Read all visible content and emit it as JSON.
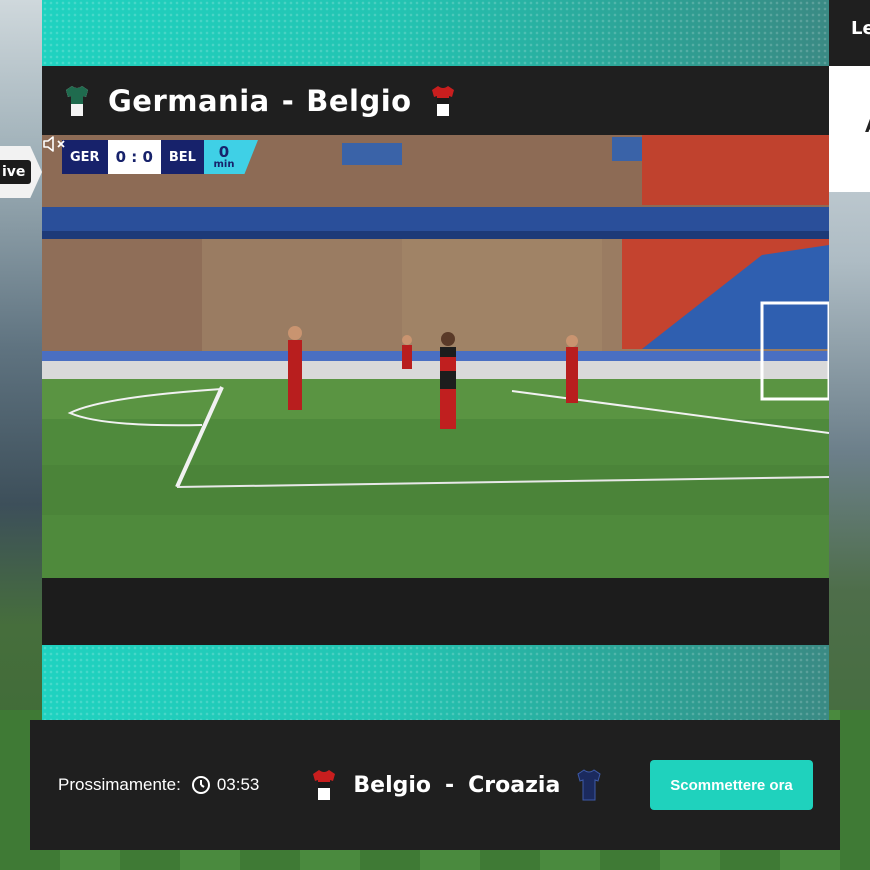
{
  "live_tag": "ive",
  "side_panel": {
    "header": "Le",
    "body": "A"
  },
  "match": {
    "home": "Germania",
    "separator": "-",
    "away": "Belgio"
  },
  "scoreboard": {
    "home_code": "GER",
    "score": "0 : 0",
    "away_code": "BEL",
    "minute": "0",
    "minute_unit": "min"
  },
  "upcoming": {
    "label": "Prossimamente:",
    "countdown": "03:53",
    "home": "Belgio",
    "separator": "-",
    "away": "Croazia"
  },
  "bet_button": "Scommettere ora",
  "icons": {
    "home_shirt": "green-white-shirt-icon",
    "away_shirt": "red-white-shirt-icon",
    "timer": "stopwatch-icon",
    "mute": "speaker-muted-icon"
  },
  "colors": {
    "accent": "#1fd2bd",
    "scoreboard_navy": "#17226b",
    "scoreboard_cyan": "#3fd0e6"
  }
}
